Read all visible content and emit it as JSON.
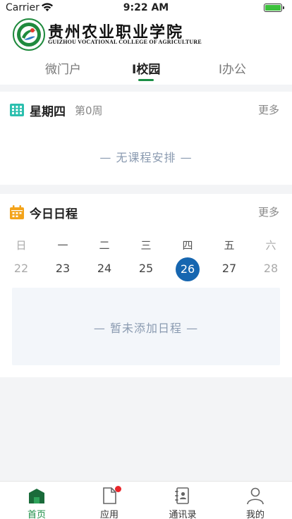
{
  "status": {
    "carrier": "Carrier",
    "time": "9:22 AM"
  },
  "header": {
    "school_name": "贵州农业职业学院",
    "school_name_en": "GUIZHOU VOCATIONAL COLLEGE OF AGRICULTURE",
    "tabs": [
      {
        "label": "微门户"
      },
      {
        "label": "I校园"
      },
      {
        "label": "I办公"
      }
    ],
    "active_tab": 1
  },
  "course_card": {
    "icon": "timetable-icon",
    "title": "星期四",
    "week": "第0周",
    "more": "更多",
    "empty": "—  无课程安排  —"
  },
  "schedule_card": {
    "icon": "calendar-icon",
    "title": "今日日程",
    "more": "更多",
    "weekdays": [
      "日",
      "一",
      "二",
      "三",
      "四",
      "五",
      "六"
    ],
    "dates": [
      "22",
      "23",
      "24",
      "25",
      "26",
      "27",
      "28"
    ],
    "today_index": 4,
    "empty": "—  暂未添加日程  —"
  },
  "tabbar": {
    "items": [
      {
        "label": "首页",
        "icon": "home-icon"
      },
      {
        "label": "应用",
        "icon": "app-doc-icon"
      },
      {
        "label": "通讯录",
        "icon": "contacts-icon"
      },
      {
        "label": "我的",
        "icon": "profile-icon"
      }
    ]
  },
  "colors": {
    "brand_green": "#1a8e45",
    "today_blue": "#1666b0",
    "badge_red": "#e8262b"
  }
}
